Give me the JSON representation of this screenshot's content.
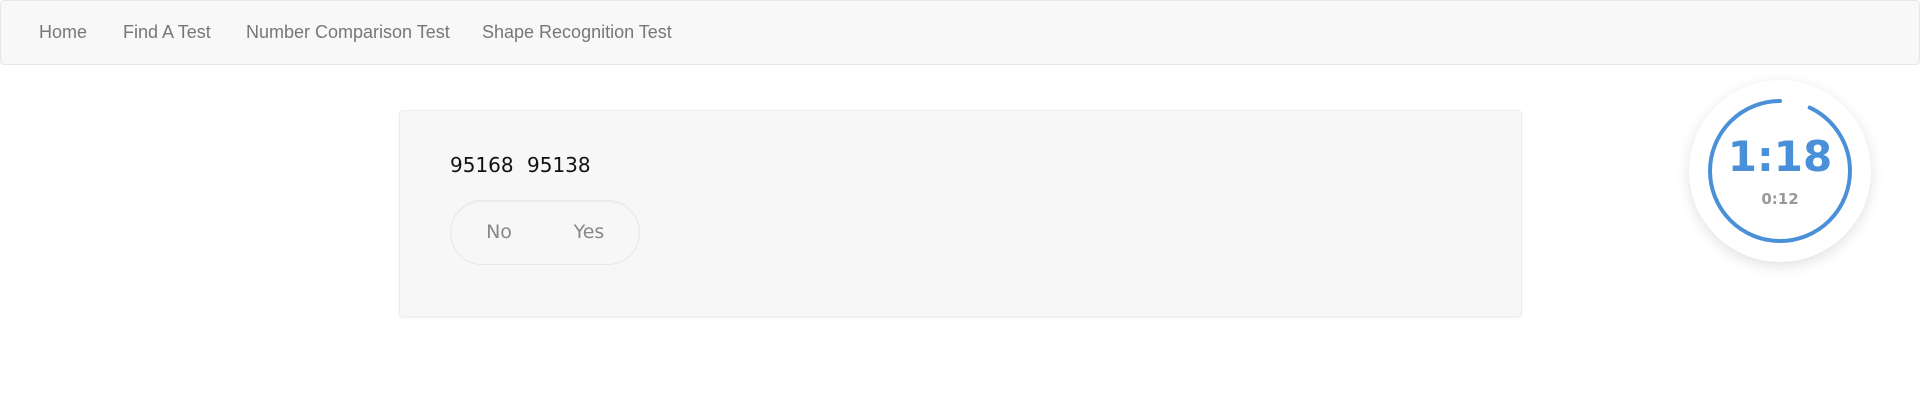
{
  "nav": {
    "items": [
      {
        "label": "Home"
      },
      {
        "label": "Find A Test"
      },
      {
        "label": "Number Comparison Test"
      },
      {
        "label": "Shape Recognition Test"
      }
    ]
  },
  "question": {
    "left_number": "95168",
    "right_number": "95138",
    "choices": {
      "no_label": "No",
      "yes_label": "Yes"
    }
  },
  "timer": {
    "main": "1:18",
    "sub": "0:12",
    "progress_fraction": 0.93,
    "accent_color": "#4a90d9"
  }
}
